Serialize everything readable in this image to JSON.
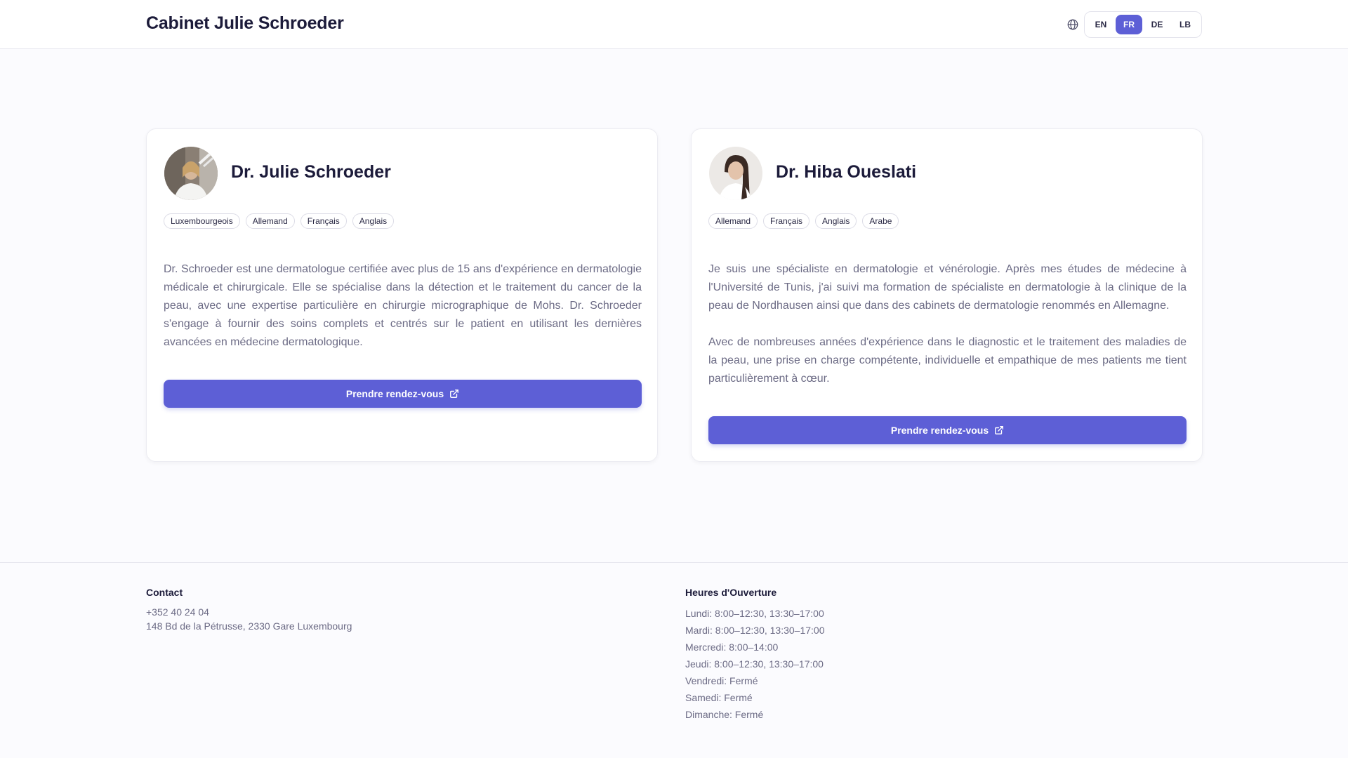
{
  "header": {
    "title": "Cabinet Julie Schroeder",
    "globe_icon": "globe-icon",
    "languages": [
      {
        "code": "EN",
        "active": false
      },
      {
        "code": "FR",
        "active": true
      },
      {
        "code": "DE",
        "active": false
      },
      {
        "code": "LB",
        "active": false
      }
    ]
  },
  "doctors": [
    {
      "name": "Dr. Julie Schroeder",
      "languages": [
        "Luxembourgeois",
        "Allemand",
        "Français",
        "Anglais"
      ],
      "bio": [
        "Dr. Schroeder est une dermatologue certifiée avec plus de 15 ans d'expérience en dermatologie médicale et chirurgicale. Elle se spécialise dans la détection et le traitement du cancer de la peau, avec une expertise particulière en chirurgie micrographique de Mohs. Dr. Schroeder s'engage à fournir des soins complets et centrés sur le patient en utilisant les dernières avancées en médecine dermatologique."
      ],
      "cta_label": "Prendre rendez-vous"
    },
    {
      "name": "Dr. Hiba Oueslati",
      "languages": [
        "Allemand",
        "Français",
        "Anglais",
        "Arabe"
      ],
      "bio": [
        "Je suis une spécialiste en dermatologie et vénérologie. Après mes études de médecine à l'Université de Tunis, j'ai suivi ma formation de spécialiste en dermatologie à la clinique de la peau de Nordhausen ainsi que dans des cabinets de dermatologie renommés en Allemagne.",
        "Avec de nombreuses années d'expérience dans le diagnostic et le traitement des maladies de la peau, une prise en charge compétente, individuelle et empathique de mes patients me tient particulièrement à cœur."
      ],
      "cta_label": "Prendre rendez-vous"
    }
  ],
  "footer": {
    "contact_heading": "Contact",
    "phone": "+352 40 24 04",
    "address": "148 Bd de la Pétrusse, 2330 Gare Luxembourg",
    "hours_heading": "Heures d'Ouverture",
    "hours": [
      "Lundi: 8:00–12:30, 13:30–17:00",
      "Mardi: 8:00–12:30, 13:30–17:00",
      "Mercredi: 8:00–14:00",
      "Jeudi: 8:00–12:30, 13:30–17:00",
      "Vendredi: Fermé",
      "Samedi: Fermé",
      "Dimanche: Fermé"
    ]
  },
  "colors": {
    "accent": "#5d5fd6",
    "text": "#1c1b3a",
    "muted": "#6c6b85"
  }
}
